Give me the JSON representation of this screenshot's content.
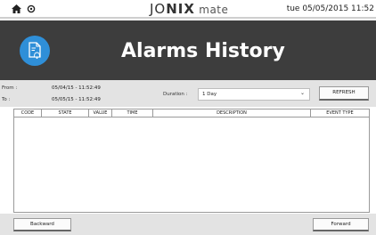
{
  "status_bar": {
    "brand_part1": "JO",
    "brand_part2": "NIX",
    "brand_part3": " mate",
    "clock": "tue 05/05/2015 11:52"
  },
  "header": {
    "title": "Alarms History",
    "icon": "alarm-document-icon",
    "icon_bg_color": "#2f8fd8"
  },
  "filter": {
    "from_label": "From :",
    "from_value": "05/04/15 - 11:52:49",
    "to_label": "To :",
    "to_value": "05/05/15 - 11:52:49",
    "duration_label": "Duration :",
    "duration_value": "1 Day",
    "refresh_label": "REFRESH"
  },
  "table": {
    "columns": [
      "CODE",
      "STATE",
      "VALUE",
      "TIME",
      "DESCRIPTION",
      "EVENT TYPE"
    ],
    "rows": []
  },
  "footer": {
    "backward_label": "Backward",
    "forward_label": "Forward"
  }
}
